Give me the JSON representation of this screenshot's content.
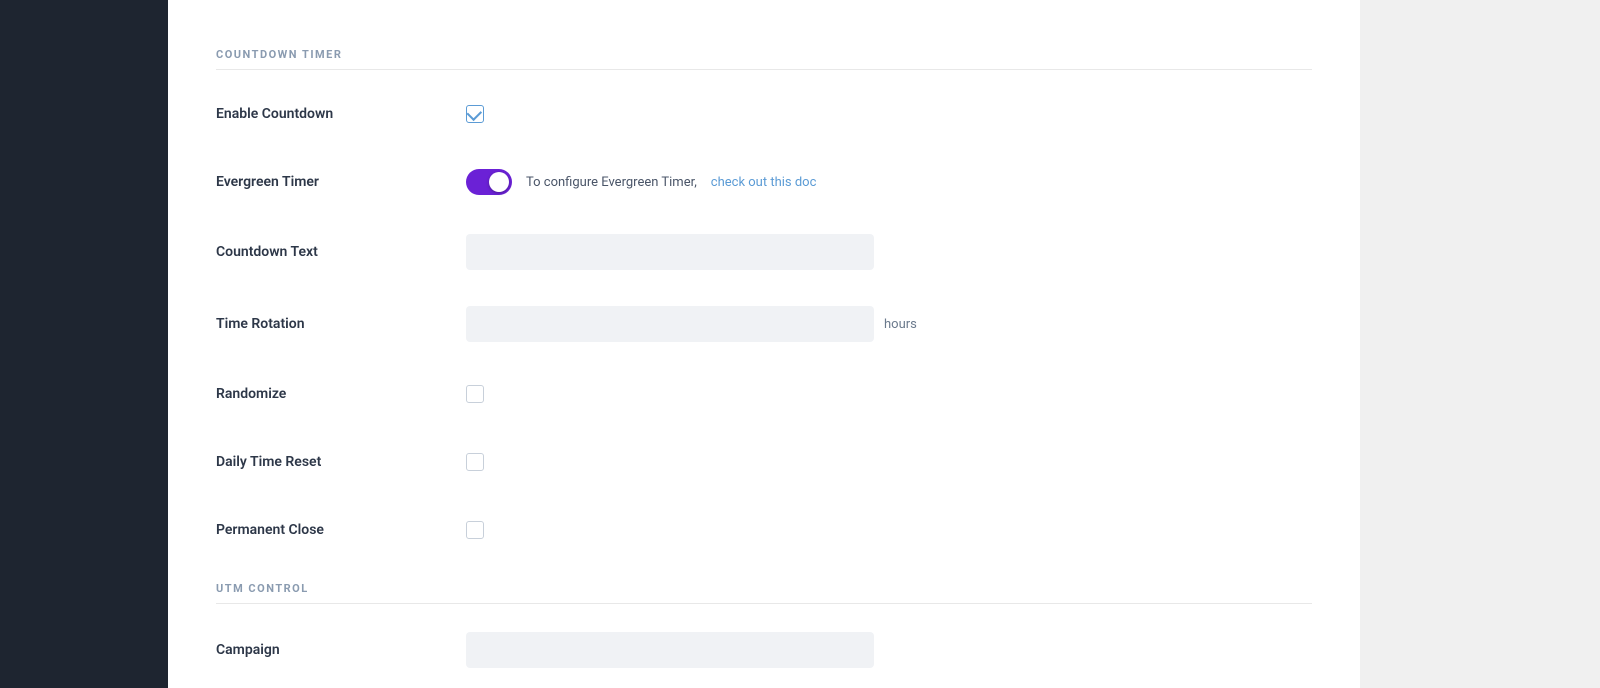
{
  "sidebar": {
    "background": "#1e2530"
  },
  "countdown_section": {
    "title": "COUNTDOWN TIMER",
    "fields": {
      "enable_countdown": {
        "label": "Enable Countdown",
        "checked": true
      },
      "evergreen_timer": {
        "label": "Evergreen Timer",
        "toggled": true,
        "helper_text": "To configure Evergreen Timer, ",
        "link_text": "check out this doc",
        "link_href": "#"
      },
      "countdown_text": {
        "label": "Countdown Text",
        "placeholder": ""
      },
      "time_rotation": {
        "label": "Time Rotation",
        "placeholder": "",
        "suffix": "hours"
      },
      "randomize": {
        "label": "Randomize",
        "checked": false
      },
      "daily_time_reset": {
        "label": "Daily Time Reset",
        "checked": false
      },
      "permanent_close": {
        "label": "Permanent Close",
        "checked": false
      }
    }
  },
  "utm_section": {
    "title": "UTM CONTROL",
    "fields": {
      "campaign": {
        "label": "Campaign",
        "placeholder": ""
      }
    }
  }
}
